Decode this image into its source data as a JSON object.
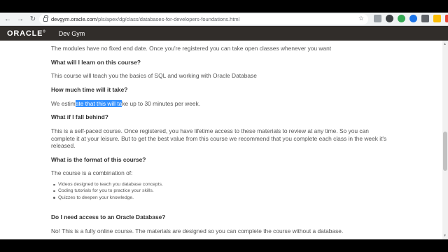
{
  "browser": {
    "url_host": "devgym.oracle.com",
    "url_path": "/pls/apex/dg/class/databases-for-developers-foundations.html",
    "icons": [
      "back-arrow-icon",
      "forward-arrow-icon",
      "reload-icon",
      "lock-icon",
      "star-icon"
    ]
  },
  "site": {
    "logo": "ORACLE",
    "logo_mark": "®",
    "app_title": "Dev Gym",
    "header_color": "#312d2a"
  },
  "content": {
    "intro": "The modules have no fixed end date. Once you're registered you can take open classes whenever you want",
    "q1": "What will I learn on this course?",
    "a1": "This course will teach you the basics of SQL and working with Oracle Database",
    "q2": "How much time will it take?",
    "a2_before": "We estim",
    "a2_selected": "ate that this will ta",
    "a2_after": "ke up to 30 minutes per week.",
    "q3": "What if I fall behind?",
    "a3": "This is a self-paced course. Once registered, you have lifetime access to these materials to review at any time. So you can complete it at your leisure. But to get the best value from this course we recommend that you complete each class in the week it's released.",
    "q4": "What is the format of this course?",
    "a4": "The course is a combination of:",
    "format_items": [
      "Videos designed to teach you database concepts.",
      "Coding tutorials for you to practice your skills.",
      "Quizzes to deepen your knowledge."
    ],
    "q5": "Do I need access to an Oracle Database?",
    "a5": "No! This is a fully online course. The materials are designed so you can complete the course without a database."
  }
}
